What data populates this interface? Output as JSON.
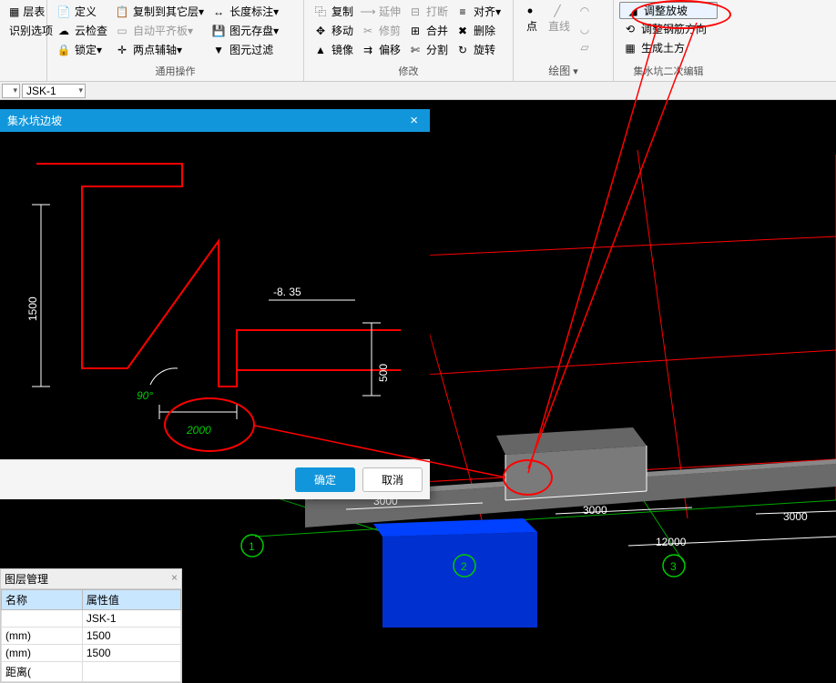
{
  "ribbon": {
    "group1": {
      "items": [
        "层表",
        "识别选项"
      ]
    },
    "group2": {
      "label": "通用操作",
      "items": [
        "定义",
        "云检查",
        "锁定",
        "复制到其它层",
        "自动平齐板",
        "两点辅轴",
        "长度标注",
        "图元存盘",
        "图元过滤"
      ]
    },
    "group3": {
      "label": "修改",
      "items": [
        "复制",
        "移动",
        "镜像",
        "延伸",
        "修剪",
        "偏移",
        "打断",
        "合并",
        "分割",
        "对齐",
        "删除",
        "旋转"
      ]
    },
    "group4": {
      "label": "绘图",
      "items": [
        "点",
        "直线"
      ]
    },
    "group5": {
      "label": "集水坑二次编辑",
      "items": [
        "调整放坡",
        "调整钢筋方向",
        "生成土方"
      ]
    }
  },
  "dropdowns": {
    "left": "▾",
    "jsk": "JSK-1"
  },
  "dialog": {
    "title": "集水坑边坡",
    "ok": "确定",
    "cancel": "取消",
    "dims": {
      "h1": "1500",
      "elev": "-8. 35",
      "h2": "500",
      "angle": "90°",
      "w": "2000"
    }
  },
  "viewport": {
    "dims": {
      "d3000a": "3000",
      "d3000b": "3000",
      "d3000c": "3000",
      "d12000": "12000"
    },
    "axes": {
      "a1": "1",
      "a2": "2",
      "a3": "3"
    }
  },
  "layerPanel": {
    "title": "图层管理",
    "pin": "×",
    "cols": [
      "名称",
      "属性值"
    ],
    "rows": [
      [
        "",
        "JSK-1"
      ],
      [
        "(mm)",
        "1500"
      ],
      [
        "(mm)",
        "1500"
      ]
    ],
    "partial": "距离("
  }
}
